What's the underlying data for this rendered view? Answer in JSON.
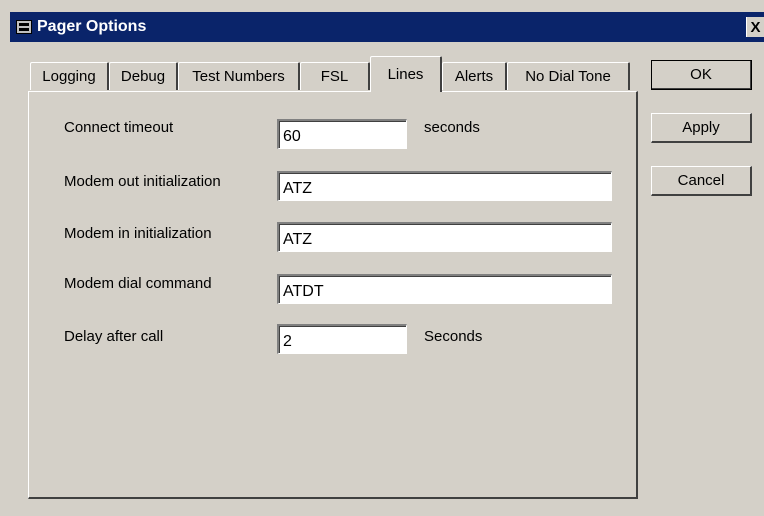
{
  "window": {
    "title": "Pager Options",
    "close_label": "X"
  },
  "tabs": [
    {
      "label": "Logging"
    },
    {
      "label": "Debug"
    },
    {
      "label": "Test Numbers"
    },
    {
      "label": "FSL"
    },
    {
      "label": "Lines",
      "active": true
    },
    {
      "label": "Alerts"
    },
    {
      "label": "No Dial Tone"
    }
  ],
  "fields": {
    "connect_timeout": {
      "label": "Connect timeout",
      "value": "60",
      "unit": "seconds"
    },
    "modem_out_init": {
      "label": "Modem out initialization",
      "value": "ATZ"
    },
    "modem_in_init": {
      "label": "Modem in initialization",
      "value": "ATZ"
    },
    "modem_dial_command": {
      "label": "Modem dial command",
      "value": "ATDT"
    },
    "delay_after_call": {
      "label": "Delay after call",
      "value": "2",
      "unit": "Seconds"
    }
  },
  "buttons": {
    "ok": "OK",
    "apply": "Apply",
    "cancel": "Cancel"
  }
}
